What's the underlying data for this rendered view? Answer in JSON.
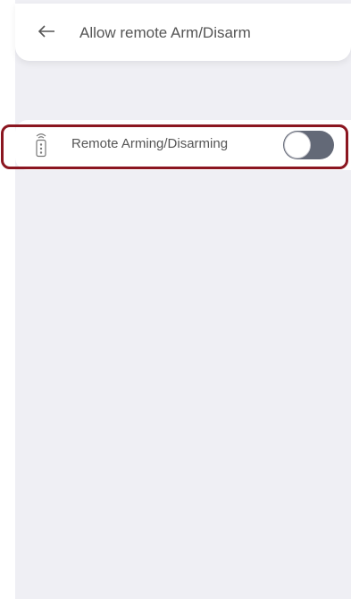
{
  "header": {
    "back_icon": "arrow-left-icon",
    "title": "Allow remote Arm/Disarm"
  },
  "settings": {
    "remote_arming": {
      "icon": "remote-control-icon",
      "label": "Remote Arming/Disarming",
      "enabled": false
    }
  },
  "colors": {
    "highlight": "#8b1620",
    "toggle_track": "#636977",
    "background": "#efeff4"
  }
}
